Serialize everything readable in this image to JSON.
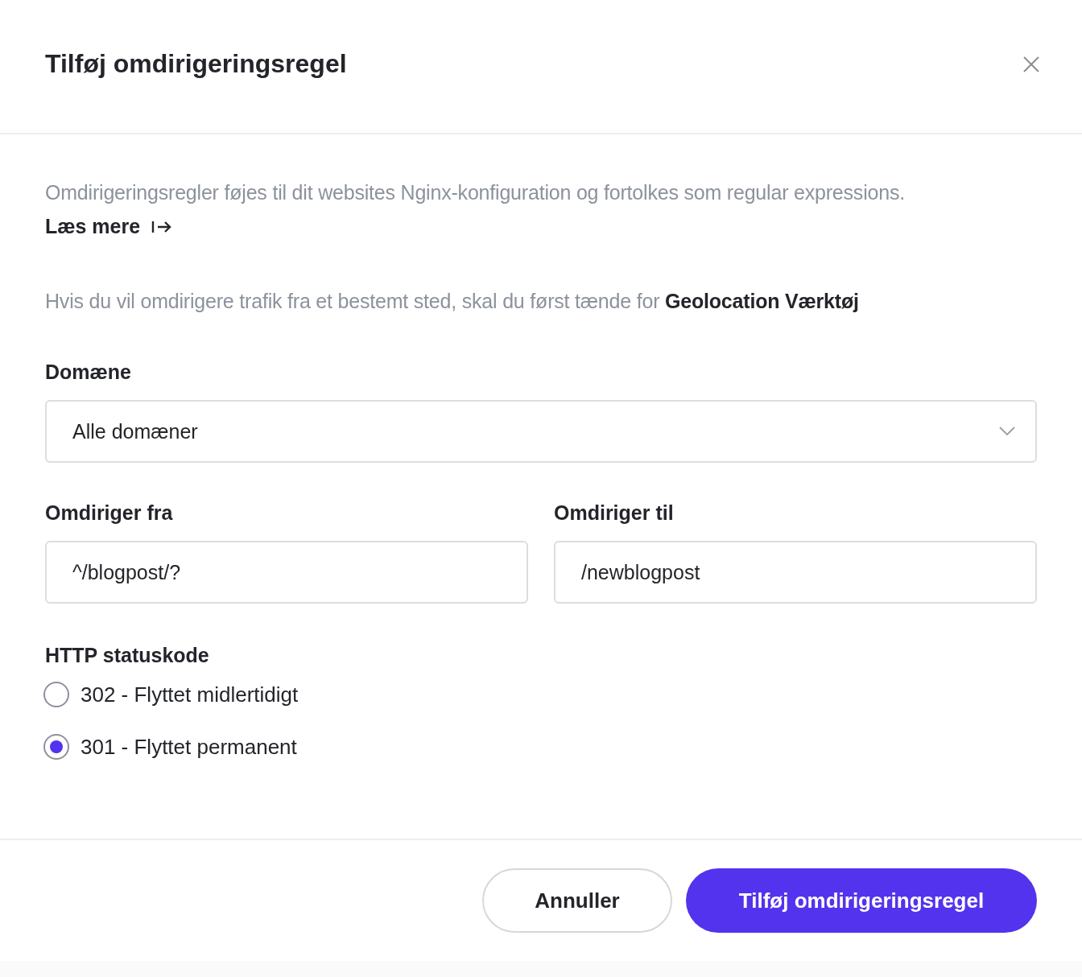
{
  "dialog": {
    "title": "Tilføj omdirigeringsregel"
  },
  "intro": {
    "text": "Omdirigeringsregler føjes til dit websites Nginx-konfiguration og fortolkes som regular expressions.",
    "link": "Læs mere"
  },
  "note": "Hvis du vil omdirigere trafik fra et bestemt sted, skal du først tænde for **Geolocation Værktøj**",
  "domain": {
    "label": "Domæne",
    "value": "Alle domæner"
  },
  "redirect_from": {
    "label": "Omdiriger fra",
    "value": "^/blogpost/?"
  },
  "redirect_to": {
    "label": "Omdiriger til",
    "value": "/newblogpost"
  },
  "status_code": {
    "label": "HTTP statuskode",
    "options": [
      {
        "label": "302 - Flyttet midlertidigt",
        "selected": false
      },
      {
        "label": "301 - Flyttet permanent",
        "selected": true
      }
    ]
  },
  "buttons": [
    {
      "label": "Annuller",
      "kind": "secondary"
    },
    {
      "label": "Tilføj omdirigeringsregel",
      "kind": "primary"
    }
  ]
}
